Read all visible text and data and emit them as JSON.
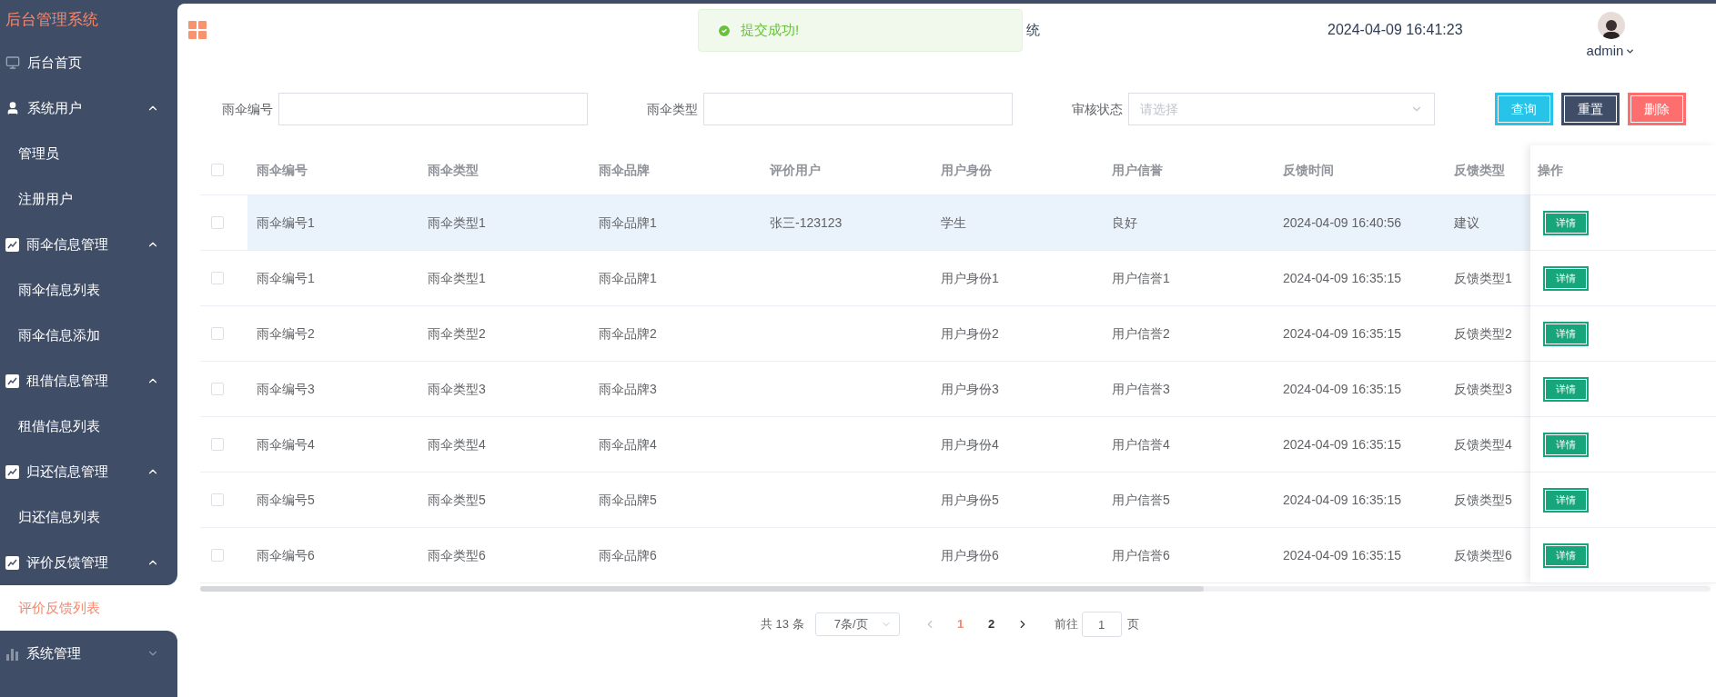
{
  "sidebar": {
    "title": "后台管理系统",
    "items": [
      {
        "kind": "link",
        "label": "后台首页",
        "selected": false
      },
      {
        "kind": "group",
        "label": "系统用户",
        "expanded": true,
        "children": [
          {
            "label": "管理员",
            "selected": false
          },
          {
            "label": "注册用户",
            "selected": false
          }
        ]
      },
      {
        "kind": "group",
        "label": "雨伞信息管理",
        "expanded": true,
        "children": [
          {
            "label": "雨伞信息列表",
            "selected": false
          },
          {
            "label": "雨伞信息添加",
            "selected": false
          }
        ]
      },
      {
        "kind": "group",
        "label": "租借信息管理",
        "expanded": true,
        "children": [
          {
            "label": "租借信息列表",
            "selected": false
          }
        ]
      },
      {
        "kind": "group",
        "label": "归还信息管理",
        "expanded": true,
        "children": [
          {
            "label": "归还信息列表",
            "selected": false
          }
        ]
      },
      {
        "kind": "group",
        "label": "评价反馈管理",
        "expanded": true,
        "children": [
          {
            "label": "评价反馈列表",
            "selected": true
          }
        ]
      },
      {
        "kind": "group",
        "label": "系统管理",
        "expanded": false
      }
    ]
  },
  "header": {
    "title_visible": "统",
    "datetime": "2024-04-09 16:41:23",
    "user": "admin"
  },
  "toast": {
    "message": "提交成功!"
  },
  "filters": [
    {
      "kind": "text",
      "label": "雨伞编号"
    },
    {
      "kind": "text",
      "label": "雨伞类型"
    },
    {
      "kind": "select",
      "label": "审核状态",
      "placeholder": "请选择"
    }
  ],
  "buttons": [
    {
      "kind": "primary",
      "label": "查询"
    },
    {
      "kind": "secondary",
      "label": "重置"
    },
    {
      "kind": "danger",
      "label": "删除"
    }
  ],
  "table": {
    "all_checked": false,
    "columns": [
      "雨伞编号",
      "雨伞类型",
      "雨伞品牌",
      "评价用户",
      "用户身份",
      "用户信誉",
      "反馈时间",
      "反馈类型"
    ],
    "action_column": "操作",
    "rows": [
      {
        "checked": false,
        "highlighted": true,
        "cells": [
          "雨伞编号1",
          "雨伞类型1",
          "雨伞品牌1",
          "张三-123123",
          "学生",
          "良好",
          "2024-04-09 16:40:56",
          "建议"
        ],
        "action": "详情"
      },
      {
        "checked": false,
        "highlighted": false,
        "cells": [
          "雨伞编号1",
          "雨伞类型1",
          "雨伞品牌1",
          null,
          "用户身份1",
          "用户信誉1",
          "2024-04-09 16:35:15",
          "反馈类型1"
        ],
        "action": "详情"
      },
      {
        "checked": false,
        "highlighted": false,
        "cells": [
          "雨伞编号2",
          "雨伞类型2",
          "雨伞品牌2",
          null,
          "用户身份2",
          "用户信誉2",
          "2024-04-09 16:35:15",
          "反馈类型2"
        ],
        "action": "详情"
      },
      {
        "checked": false,
        "highlighted": false,
        "cells": [
          "雨伞编号3",
          "雨伞类型3",
          "雨伞品牌3",
          null,
          "用户身份3",
          "用户信誉3",
          "2024-04-09 16:35:15",
          "反馈类型3"
        ],
        "action": "详情"
      },
      {
        "checked": false,
        "highlighted": false,
        "cells": [
          "雨伞编号4",
          "雨伞类型4",
          "雨伞品牌4",
          null,
          "用户身份4",
          "用户信誉4",
          "2024-04-09 16:35:15",
          "反馈类型4"
        ],
        "action": "详情"
      },
      {
        "checked": false,
        "highlighted": false,
        "cells": [
          "雨伞编号5",
          "雨伞类型5",
          "雨伞品牌5",
          null,
          "用户身份5",
          "用户信誉5",
          "2024-04-09 16:35:15",
          "反馈类型5"
        ],
        "action": "详情"
      },
      {
        "checked": false,
        "highlighted": false,
        "cells": [
          "雨伞编号6",
          "雨伞类型6",
          "雨伞品牌6",
          null,
          "用户身份6",
          "用户信誉6",
          "2024-04-09 16:35:15",
          "反馈类型6"
        ],
        "action": "详情"
      }
    ]
  },
  "pagination": {
    "total": "共 13 条",
    "page_size": "7条/页",
    "prev_disabled": true,
    "next_disabled": false,
    "pages": [
      {
        "label": "1",
        "selected": true
      },
      {
        "label": "2",
        "selected": false
      }
    ],
    "goto_label": "前往",
    "goto_value": "1",
    "page_suffix": "页"
  }
}
